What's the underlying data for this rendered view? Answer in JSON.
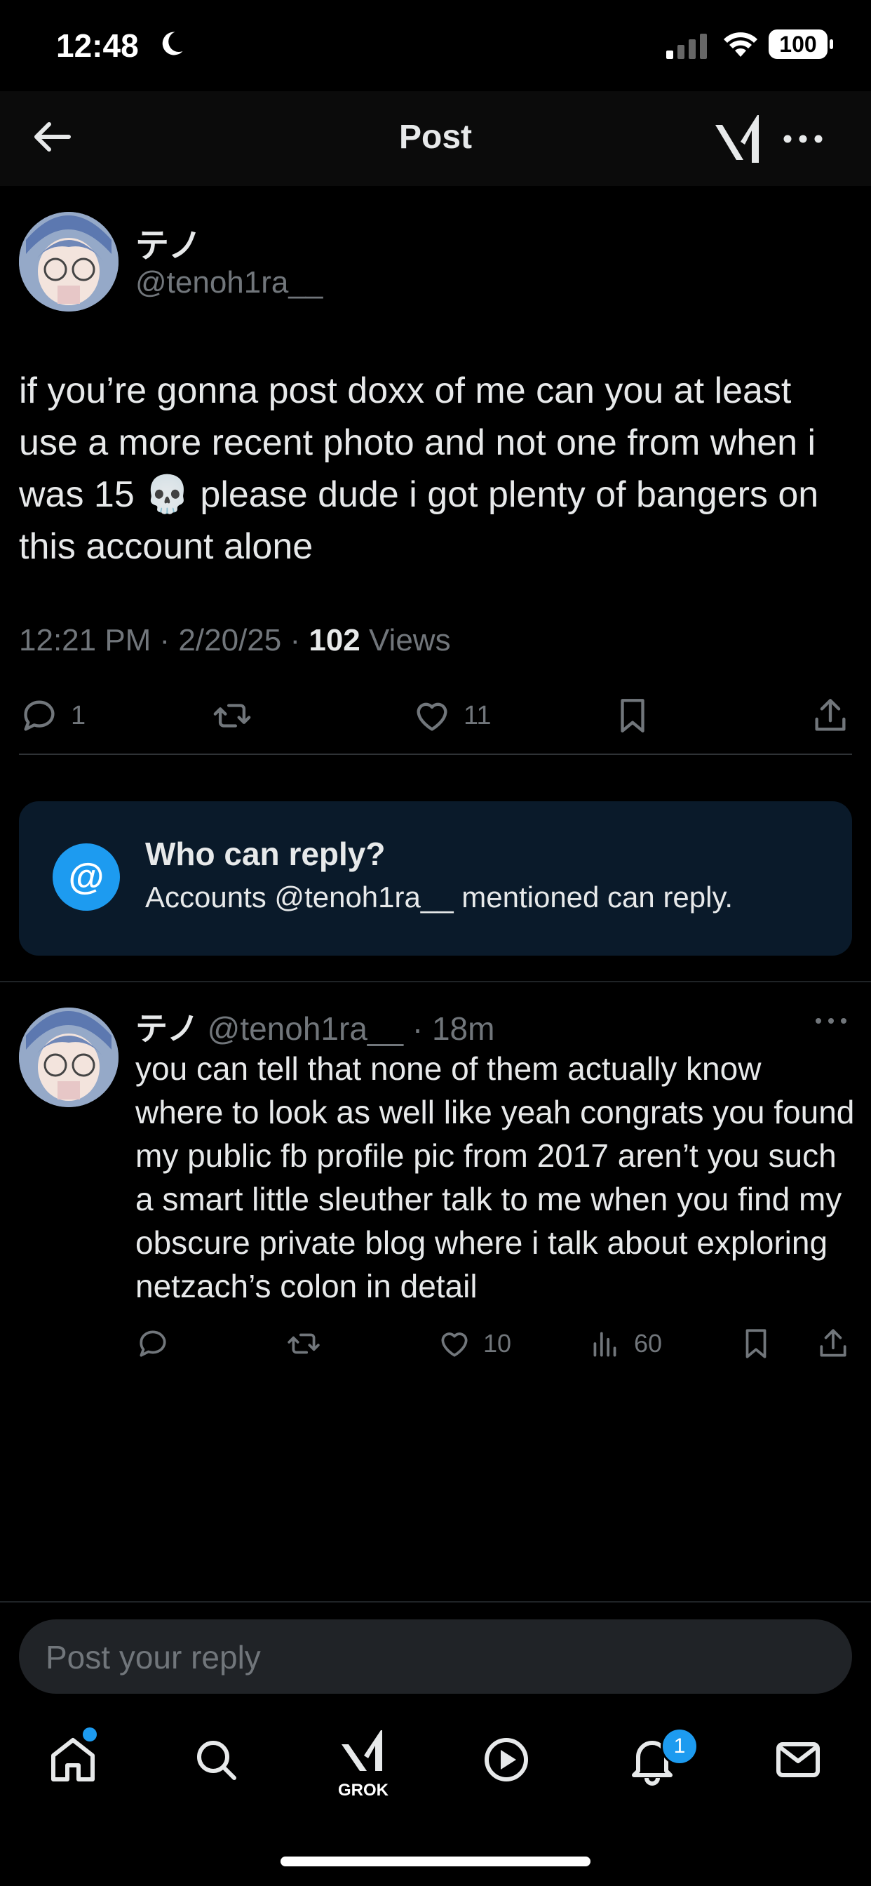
{
  "status_bar": {
    "time": "12:48",
    "battery": "100"
  },
  "header": {
    "title": "Post"
  },
  "post": {
    "author_name": "テノ",
    "author_handle": "@tenoh1ra__",
    "text": "if you’re gonna post doxx of me can you at least use a more recent photo and not one from when i was 15 💀 please dude i got plenty of bangers on this account alone",
    "time": "12:21 PM · 2/20/25 · ",
    "views_count": "102",
    "views_label": " Views",
    "replies": "1",
    "likes": "11"
  },
  "reply_restriction": {
    "icon": "@",
    "title": "Who can reply?",
    "subtitle": "Accounts @tenoh1ra__ mentioned can reply."
  },
  "reply": {
    "author_name": "テノ",
    "meta": "@tenoh1ra__ · 18m",
    "text": "you can tell that none of them actually know where to look as well like yeah congrats you found my public fb profile pic from 2017 aren’t you such a smart little sleuther talk to me when you find my obscure private blog where i talk about exploring netzach’s colon in detail",
    "likes": "10",
    "views": "60"
  },
  "composer": {
    "placeholder": "Post your reply"
  },
  "tabbar": {
    "grok_label": "GROK",
    "notifications_badge": "1"
  },
  "colors": {
    "accent": "#1d9bf0",
    "muted": "#71767b",
    "text": "#e7e9ea"
  }
}
